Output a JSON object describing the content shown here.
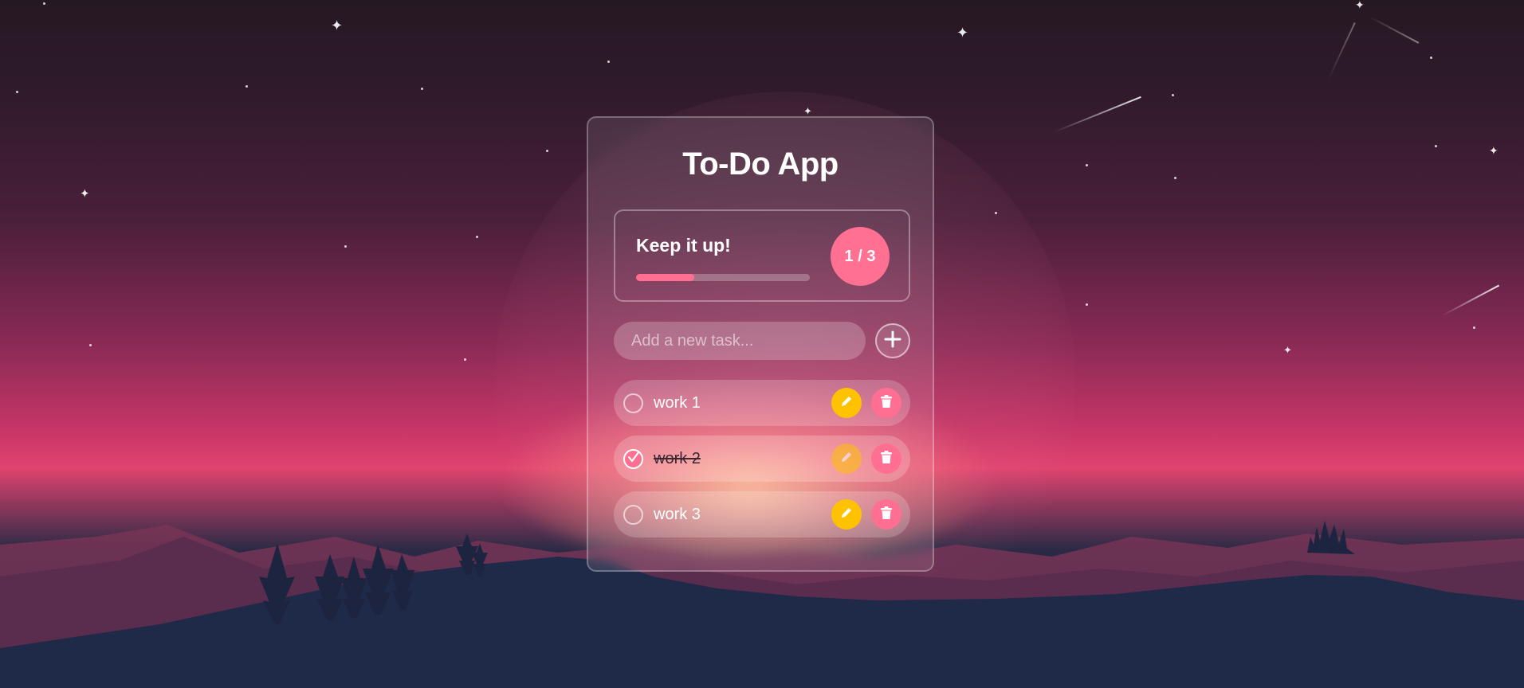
{
  "app": {
    "title": "To-Do App"
  },
  "stats": {
    "message": "Keep it up!",
    "completed": 1,
    "total": 3,
    "counter_text": "1 / 3",
    "progress": 0.333
  },
  "new_task": {
    "placeholder": "Add a new task...",
    "value": ""
  },
  "tasks": [
    {
      "label": "work 1",
      "done": false
    },
    {
      "label": "work 2",
      "done": true
    },
    {
      "label": "work 3",
      "done": false
    }
  ],
  "icons": {
    "add": "plus-icon",
    "edit": "pencil-icon",
    "delete": "trash-icon",
    "check": "checkmark-icon"
  },
  "colors": {
    "accent": "#ff6f91",
    "edit": "#fec200",
    "text": "#ffffff"
  }
}
